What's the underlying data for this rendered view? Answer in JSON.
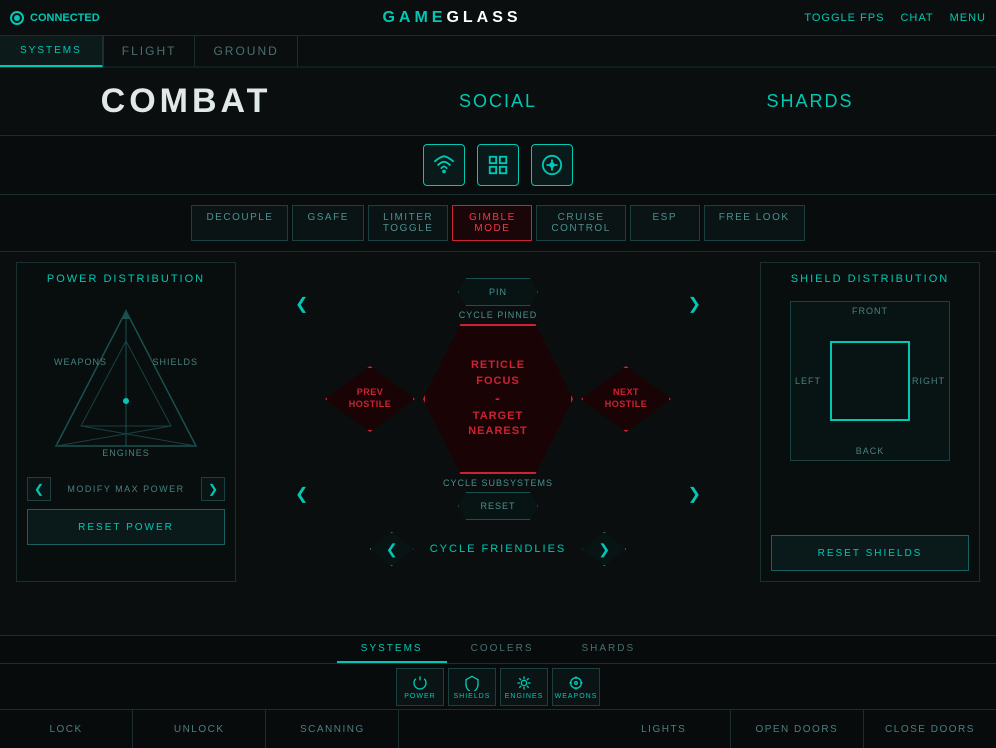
{
  "topbar": {
    "connected_label": "CONNECTED",
    "brand_game": "GAME",
    "brand_glass": "GLASS",
    "toggle_fps": "TOGGLE FPS",
    "chat": "CHAT",
    "menu": "MENU"
  },
  "systems_tab": {
    "label": "SYSTEMS"
  },
  "main_nav": {
    "flight": "FLIGHT",
    "ground": "GROUND",
    "combat": "COMBAT",
    "social": "SOCIAL",
    "shards": "SHARDS"
  },
  "toggle_bar": {
    "buttons": [
      {
        "label": "DECOUPLE",
        "active": false
      },
      {
        "label": "GSAFE",
        "active": false
      },
      {
        "label": "LIMITER TOGGLE",
        "active": false
      },
      {
        "label": "GIMBLE MODE",
        "active": true
      },
      {
        "label": "CRUISE CONTROL",
        "active": false
      },
      {
        "label": "ESP",
        "active": false
      },
      {
        "label": "FREE LOOK",
        "active": false
      }
    ]
  },
  "power_panel": {
    "title": "POWER DISTRIBUTION",
    "weapons_label": "WEAPONS",
    "shields_label": "SHIELDS",
    "engines_label": "ENGINES",
    "modify_label": "MODIFY MAX POWER",
    "reset_label": "RESET POWER"
  },
  "target_system": {
    "pin_label": "PIN",
    "cycle_pinned": "CYCLE PINNED",
    "prev_hostile": "PREV\nHOSTILE",
    "reticle_focus": "RETICLE\nFOCUS",
    "separator": "-",
    "target_nearest": "TARGET\nNEAREST",
    "next_hostile": "NEXT\nHOSTILE",
    "cycle_subsystems": "CYCLE SUBSYSTEMS",
    "reset_label": "RESET",
    "cycle_friendlies": "CYCLE FRIENDLIES"
  },
  "shield_panel": {
    "title": "SHIELD DISTRIBUTION",
    "front_label": "FRONT",
    "back_label": "BACK",
    "left_label": "LEFT",
    "right_label": "RIGHT",
    "reset_label": "RESET SHIELDS"
  },
  "bottom_section": {
    "tabs": [
      "SYSTEMS",
      "COOLERS",
      "SHARDS"
    ],
    "icons": [
      {
        "label": "POWER"
      },
      {
        "label": "SHIELDS"
      },
      {
        "label": "ENGINES"
      },
      {
        "label": "WEAPONS"
      }
    ],
    "actions": [
      "LOCK",
      "UNLOCK",
      "SCANNING",
      "",
      "LIGHTS",
      "OPEN DOORS",
      "CLOSE DOORS"
    ]
  }
}
